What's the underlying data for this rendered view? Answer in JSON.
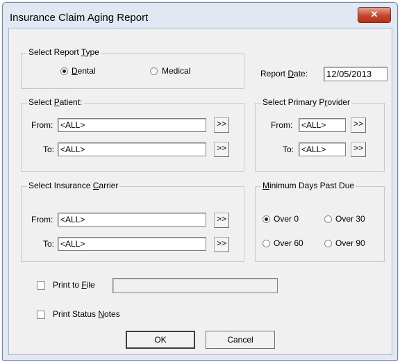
{
  "window": {
    "title": "Insurance Claim Aging Report",
    "close_glyph": "✕"
  },
  "report_type": {
    "legend_pre": "Select Report ",
    "legend_key": "T",
    "legend_post": "ype",
    "dental_pre": "",
    "dental_key": "D",
    "dental_post": "ental",
    "medical_label": "Medical",
    "selected": "Dental"
  },
  "report_date": {
    "label_pre": "Report ",
    "label_key": "D",
    "label_post": "ate:",
    "value": "12/05/2013"
  },
  "patient": {
    "legend_pre": "Select ",
    "legend_key": "P",
    "legend_post": "atient:",
    "from_label": "From:",
    "from_value": "<ALL>",
    "to_label": "To:",
    "to_value": "<ALL>",
    "browse_label": ">>"
  },
  "provider": {
    "legend_pre": "Select Primary P",
    "legend_key": "r",
    "legend_post": "ovider",
    "from_label": "From:",
    "from_value": "<ALL>",
    "to_label": "To:",
    "to_value": "<ALL>",
    "browse_label": ">>"
  },
  "carrier": {
    "legend_pre": "Select Insurance ",
    "legend_key": "C",
    "legend_post": "arrier",
    "from_label": "From:",
    "from_value": "<ALL>",
    "to_label": "To:",
    "to_value": "<ALL>",
    "browse_label": ">>"
  },
  "days_past_due": {
    "legend_pre": "",
    "legend_key": "M",
    "legend_post": "inimum Days Past Due",
    "options": [
      "Over 0",
      "Over 30",
      "Over 60",
      "Over 90"
    ],
    "selected": "Over 0"
  },
  "print_to_file": {
    "label_pre": "Print to ",
    "label_key": "F",
    "label_post": "ile",
    "checked": false,
    "path": ""
  },
  "print_status_notes": {
    "label_pre": "Print Status ",
    "label_key": "N",
    "label_post": "otes",
    "checked": false
  },
  "buttons": {
    "ok": "OK",
    "cancel": "Cancel"
  }
}
